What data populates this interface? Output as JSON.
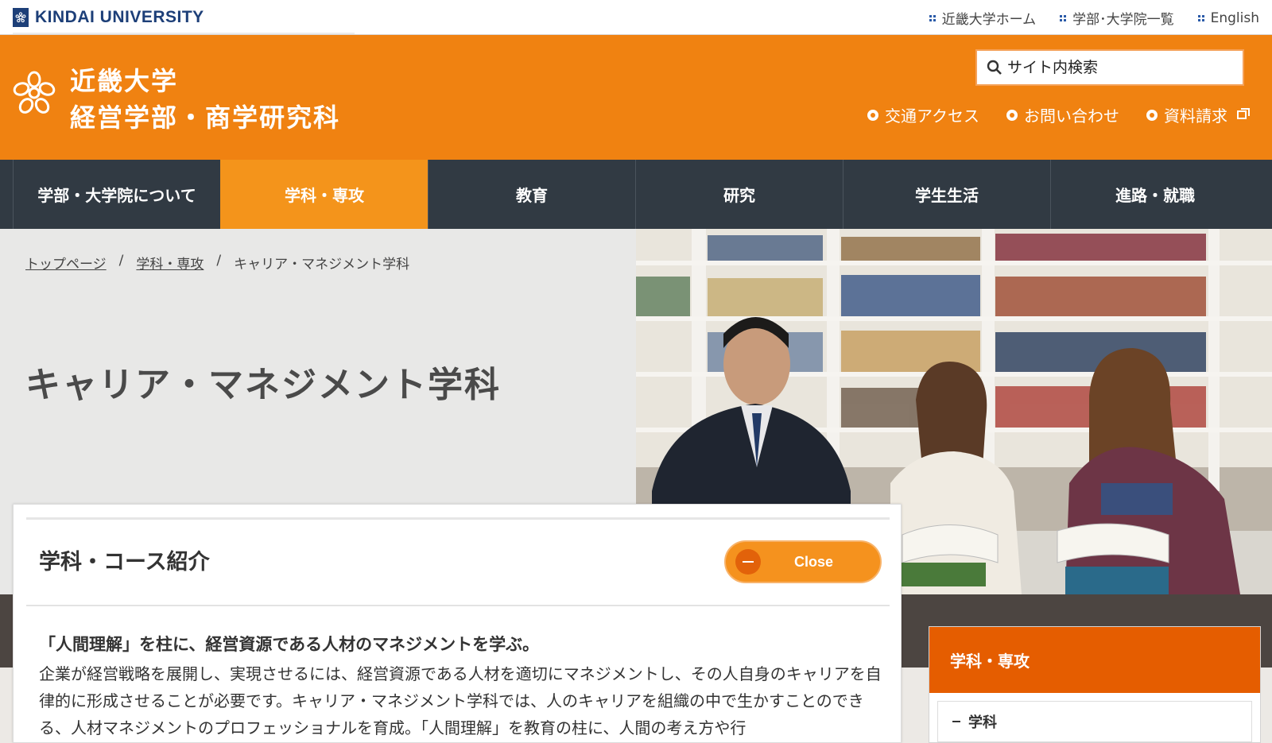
{
  "topbar": {
    "brand": "KINDAI UNIVERSITY",
    "links": [
      {
        "label": "近畿大学ホーム"
      },
      {
        "label": "学部･大学院一覧"
      },
      {
        "label": "English"
      }
    ]
  },
  "header": {
    "title_line1": "近畿大学",
    "title_line2": "経営学部・商学研究科",
    "search_placeholder": "サイト内検索",
    "util_links": [
      {
        "label": "交通アクセス"
      },
      {
        "label": "お問い合わせ"
      },
      {
        "label": "資料請求"
      }
    ]
  },
  "nav": {
    "items": [
      {
        "label": "学部・大学院について"
      },
      {
        "label": "学科・専攻"
      },
      {
        "label": "教育"
      },
      {
        "label": "研究"
      },
      {
        "label": "学生生活"
      },
      {
        "label": "進路・就職"
      }
    ]
  },
  "breadcrumb": {
    "home": "トップページ",
    "section": "学科・専攻",
    "sep": "/",
    "current": "キャリア・マネジメント学科"
  },
  "hero": {
    "title": "キャリア・マネジメント学科"
  },
  "panel": {
    "title": "学科・コース紹介",
    "close_label": "Close",
    "lead": "「人間理解」を柱に、経営資源である人材のマネジメントを学ぶ。",
    "body": "企業が経営戦略を展開し、実現させるには、経営資源である人材を適切にマネジメントし、その人自身のキャリアを自律的に形成させることが必要です。キャリア・マネジメント学科では、人のキャリアを組織の中で生かすことのできる、人材マネジメントのプロフェッショナルを育成。「人間理解」を教育の柱に、人間の考え方や行"
  },
  "side": {
    "heading": "学科・専攻",
    "item": "学科"
  },
  "colors": {
    "header_orange": "#f08211",
    "nav_active": "#f4941b",
    "nav_bg": "#313a43",
    "side_head": "#e55d00",
    "brand_blue": "#1d3f78"
  }
}
